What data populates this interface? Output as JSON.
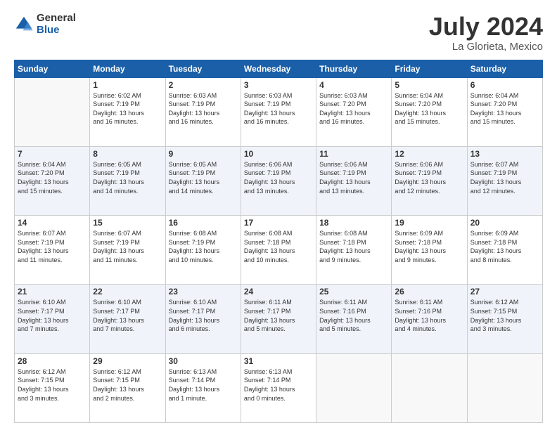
{
  "logo": {
    "general": "General",
    "blue": "Blue"
  },
  "title": "July 2024",
  "location": "La Glorieta, Mexico",
  "weekdays": [
    "Sunday",
    "Monday",
    "Tuesday",
    "Wednesday",
    "Thursday",
    "Friday",
    "Saturday"
  ],
  "weeks": [
    [
      {
        "day": "",
        "info": ""
      },
      {
        "day": "1",
        "info": "Sunrise: 6:02 AM\nSunset: 7:19 PM\nDaylight: 13 hours\nand 16 minutes."
      },
      {
        "day": "2",
        "info": "Sunrise: 6:03 AM\nSunset: 7:19 PM\nDaylight: 13 hours\nand 16 minutes."
      },
      {
        "day": "3",
        "info": "Sunrise: 6:03 AM\nSunset: 7:19 PM\nDaylight: 13 hours\nand 16 minutes."
      },
      {
        "day": "4",
        "info": "Sunrise: 6:03 AM\nSunset: 7:20 PM\nDaylight: 13 hours\nand 16 minutes."
      },
      {
        "day": "5",
        "info": "Sunrise: 6:04 AM\nSunset: 7:20 PM\nDaylight: 13 hours\nand 15 minutes."
      },
      {
        "day": "6",
        "info": "Sunrise: 6:04 AM\nSunset: 7:20 PM\nDaylight: 13 hours\nand 15 minutes."
      }
    ],
    [
      {
        "day": "7",
        "info": "Sunrise: 6:04 AM\nSunset: 7:20 PM\nDaylight: 13 hours\nand 15 minutes."
      },
      {
        "day": "8",
        "info": "Sunrise: 6:05 AM\nSunset: 7:19 PM\nDaylight: 13 hours\nand 14 minutes."
      },
      {
        "day": "9",
        "info": "Sunrise: 6:05 AM\nSunset: 7:19 PM\nDaylight: 13 hours\nand 14 minutes."
      },
      {
        "day": "10",
        "info": "Sunrise: 6:06 AM\nSunset: 7:19 PM\nDaylight: 13 hours\nand 13 minutes."
      },
      {
        "day": "11",
        "info": "Sunrise: 6:06 AM\nSunset: 7:19 PM\nDaylight: 13 hours\nand 13 minutes."
      },
      {
        "day": "12",
        "info": "Sunrise: 6:06 AM\nSunset: 7:19 PM\nDaylight: 13 hours\nand 12 minutes."
      },
      {
        "day": "13",
        "info": "Sunrise: 6:07 AM\nSunset: 7:19 PM\nDaylight: 13 hours\nand 12 minutes."
      }
    ],
    [
      {
        "day": "14",
        "info": "Sunrise: 6:07 AM\nSunset: 7:19 PM\nDaylight: 13 hours\nand 11 minutes."
      },
      {
        "day": "15",
        "info": "Sunrise: 6:07 AM\nSunset: 7:19 PM\nDaylight: 13 hours\nand 11 minutes."
      },
      {
        "day": "16",
        "info": "Sunrise: 6:08 AM\nSunset: 7:19 PM\nDaylight: 13 hours\nand 10 minutes."
      },
      {
        "day": "17",
        "info": "Sunrise: 6:08 AM\nSunset: 7:18 PM\nDaylight: 13 hours\nand 10 minutes."
      },
      {
        "day": "18",
        "info": "Sunrise: 6:08 AM\nSunset: 7:18 PM\nDaylight: 13 hours\nand 9 minutes."
      },
      {
        "day": "19",
        "info": "Sunrise: 6:09 AM\nSunset: 7:18 PM\nDaylight: 13 hours\nand 9 minutes."
      },
      {
        "day": "20",
        "info": "Sunrise: 6:09 AM\nSunset: 7:18 PM\nDaylight: 13 hours\nand 8 minutes."
      }
    ],
    [
      {
        "day": "21",
        "info": "Sunrise: 6:10 AM\nSunset: 7:17 PM\nDaylight: 13 hours\nand 7 minutes."
      },
      {
        "day": "22",
        "info": "Sunrise: 6:10 AM\nSunset: 7:17 PM\nDaylight: 13 hours\nand 7 minutes."
      },
      {
        "day": "23",
        "info": "Sunrise: 6:10 AM\nSunset: 7:17 PM\nDaylight: 13 hours\nand 6 minutes."
      },
      {
        "day": "24",
        "info": "Sunrise: 6:11 AM\nSunset: 7:17 PM\nDaylight: 13 hours\nand 5 minutes."
      },
      {
        "day": "25",
        "info": "Sunrise: 6:11 AM\nSunset: 7:16 PM\nDaylight: 13 hours\nand 5 minutes."
      },
      {
        "day": "26",
        "info": "Sunrise: 6:11 AM\nSunset: 7:16 PM\nDaylight: 13 hours\nand 4 minutes."
      },
      {
        "day": "27",
        "info": "Sunrise: 6:12 AM\nSunset: 7:15 PM\nDaylight: 13 hours\nand 3 minutes."
      }
    ],
    [
      {
        "day": "28",
        "info": "Sunrise: 6:12 AM\nSunset: 7:15 PM\nDaylight: 13 hours\nand 3 minutes."
      },
      {
        "day": "29",
        "info": "Sunrise: 6:12 AM\nSunset: 7:15 PM\nDaylight: 13 hours\nand 2 minutes."
      },
      {
        "day": "30",
        "info": "Sunrise: 6:13 AM\nSunset: 7:14 PM\nDaylight: 13 hours\nand 1 minute."
      },
      {
        "day": "31",
        "info": "Sunrise: 6:13 AM\nSunset: 7:14 PM\nDaylight: 13 hours\nand 0 minutes."
      },
      {
        "day": "",
        "info": ""
      },
      {
        "day": "",
        "info": ""
      },
      {
        "day": "",
        "info": ""
      }
    ]
  ]
}
